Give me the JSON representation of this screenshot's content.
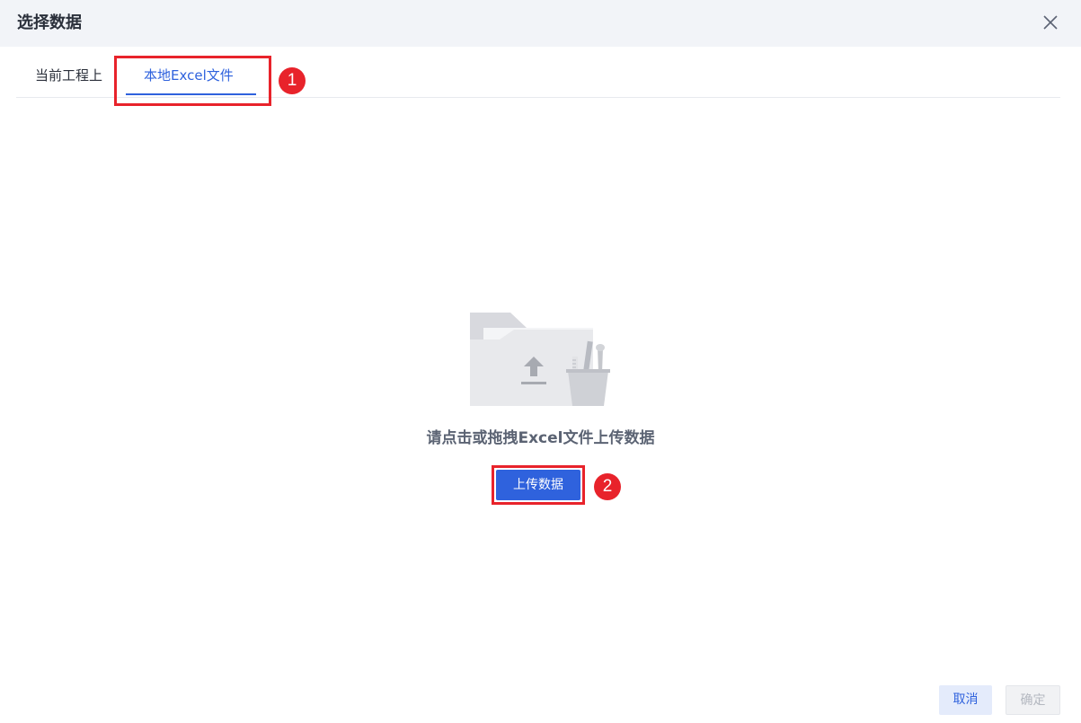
{
  "dialog": {
    "title": "选择数据",
    "close_icon": "close-icon"
  },
  "tabs": [
    {
      "label": "当前工程上",
      "active": false
    },
    {
      "label": "本地Excel文件",
      "active": true
    }
  ],
  "annotations": {
    "marker_1": "1",
    "marker_2": "2",
    "highlight_color": "#e8232b"
  },
  "upload": {
    "illustration_icon": "folder-upload-icon",
    "hint": "请点击或拖拽Excel文件上传数据",
    "button_label": "上传数据"
  },
  "footer": {
    "cancel_label": "取消",
    "confirm_label": "确定",
    "confirm_enabled": false
  },
  "colors": {
    "accent": "#2f62dd",
    "header_bg": "#f2f4f8",
    "annotation_red": "#e8232b"
  }
}
